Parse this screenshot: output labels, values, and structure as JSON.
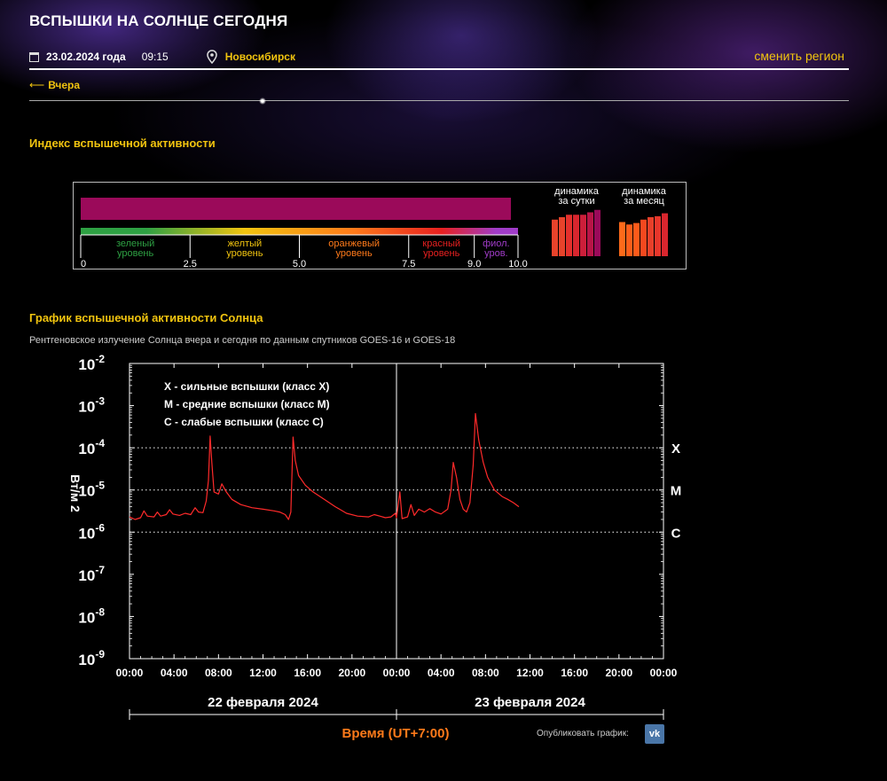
{
  "header": {
    "title": "Вспышки на Солнце сегодня",
    "date": "23.02.2024 года",
    "time": "09:15",
    "city": "Новосибирск",
    "change_region": "сменить регион",
    "back_label": "Вчера"
  },
  "flare_index": {
    "heading": "Индекс вспышечной активности",
    "value": 10.0,
    "scale_ticks": [
      "0",
      "2.5",
      "5.0",
      "7.5",
      "9.0",
      "10.0"
    ],
    "levels": [
      {
        "label": "зеленый уровень",
        "line1": "зеленый",
        "line2": "уровень",
        "range": [
          0,
          2.5
        ],
        "color": "#2ea043"
      },
      {
        "label": "желтый уровень",
        "line1": "желтый",
        "line2": "уровень",
        "range": [
          2.5,
          5.0
        ],
        "color": "#f1c40f"
      },
      {
        "label": "оранжевый уровень",
        "line1": "оранжевый",
        "line2": "уровень",
        "range": [
          5.0,
          7.5
        ],
        "color": "#ff7a1a"
      },
      {
        "label": "красный уровень",
        "line1": "красный",
        "line2": "уровень",
        "range": [
          7.5,
          9.0
        ],
        "color": "#e82020"
      },
      {
        "label": "фиол. уров.",
        "line1": "фиол.",
        "line2": "уров.",
        "range": [
          9.0,
          10.0
        ],
        "color": "#a03cc8"
      }
    ],
    "bar_color": "#9b0a5a",
    "daily": {
      "label_line1": "динамика",
      "label_line2": "за сутки",
      "values": [
        0.75,
        0.8,
        0.85,
        0.85,
        0.85,
        0.9,
        0.95
      ]
    },
    "monthly": {
      "label_line1": "динамика",
      "label_line2": "за месяц",
      "values": [
        0.7,
        0.65,
        0.68,
        0.75,
        0.8,
        0.82,
        0.88
      ]
    }
  },
  "graph": {
    "heading": "График вспышечной активности Солнца",
    "subtitle": "Рентгеновское излучение Солнца вчера и сегодня по данным спутников GOES-16 и GOES-18",
    "publish_label": "Опубликовать график:",
    "vk_label": "vk"
  },
  "chart_data": {
    "type": "line",
    "ylabel": "Вт/м 2",
    "xlabel": "Время (UT+7:00)",
    "y_scale": "log",
    "ylim": [
      1e-09,
      0.01
    ],
    "y_ticks": [
      {
        "base": "10",
        "exp": "-2",
        "value": 0.01
      },
      {
        "base": "10",
        "exp": "-3",
        "value": 0.001
      },
      {
        "base": "10",
        "exp": "-4",
        "value": 0.0001
      },
      {
        "base": "10",
        "exp": "-5",
        "value": 1e-05
      },
      {
        "base": "10",
        "exp": "-6",
        "value": 1e-06
      },
      {
        "base": "10",
        "exp": "-7",
        "value": 1e-07
      },
      {
        "base": "10",
        "exp": "-8",
        "value": 1e-08
      },
      {
        "base": "10",
        "exp": "-9",
        "value": 1e-09
      }
    ],
    "xlim": [
      0,
      48
    ],
    "x_ticks": [
      "00:00",
      "04:00",
      "08:00",
      "12:00",
      "16:00",
      "20:00",
      "00:00",
      "04:00",
      "08:00",
      "12:00",
      "16:00",
      "20:00",
      "00:00"
    ],
    "day_labels": [
      "22 февраля 2024",
      "23 февраля 2024"
    ],
    "class_lines": [
      {
        "label": "X",
        "value": 0.0001
      },
      {
        "label": "M",
        "value": 1e-05
      },
      {
        "label": "C",
        "value": 1e-06
      }
    ],
    "legend": [
      "X - сильные вспышки (класс X)",
      "M - средние вспышки (класс M)",
      "C - слабые вспышки (класс C)"
    ],
    "series": [
      {
        "color": "#ff2a2a",
        "points": [
          [
            0.0,
            2.3e-06
          ],
          [
            0.5,
            2e-06
          ],
          [
            1.0,
            2.2e-06
          ],
          [
            1.3,
            3.2e-06
          ],
          [
            1.6,
            2.4e-06
          ],
          [
            2.2,
            2.3e-06
          ],
          [
            2.5,
            3e-06
          ],
          [
            2.8,
            2.4e-06
          ],
          [
            3.3,
            2.6e-06
          ],
          [
            3.6,
            3.4e-06
          ],
          [
            3.9,
            2.7e-06
          ],
          [
            4.5,
            2.5e-06
          ],
          [
            5.0,
            2.8e-06
          ],
          [
            5.5,
            2.6e-06
          ],
          [
            5.9,
            3.8e-06
          ],
          [
            6.2,
            3e-06
          ],
          [
            6.6,
            2.9e-06
          ],
          [
            6.9,
            5.5e-06
          ],
          [
            7.1,
            1.7e-05
          ],
          [
            7.25,
            0.00019
          ],
          [
            7.4,
            4.5e-05
          ],
          [
            7.6,
            9e-06
          ],
          [
            8.0,
            8e-06
          ],
          [
            8.3,
            1.4e-05
          ],
          [
            8.7,
            9e-06
          ],
          [
            9.2,
            6e-06
          ],
          [
            10.0,
            4.5e-06
          ],
          [
            11.0,
            3.8e-06
          ],
          [
            12.0,
            3.5e-06
          ],
          [
            13.0,
            3.2e-06
          ],
          [
            13.5,
            3e-06
          ],
          [
            14.0,
            2.6e-06
          ],
          [
            14.3,
            2e-06
          ],
          [
            14.5,
            3e-06
          ],
          [
            14.7,
            0.00018
          ],
          [
            14.9,
            5e-05
          ],
          [
            15.2,
            2.2e-05
          ],
          [
            15.8,
            1.3e-05
          ],
          [
            16.5,
            9e-06
          ],
          [
            17.5,
            6e-06
          ],
          [
            18.5,
            4e-06
          ],
          [
            19.5,
            2.8e-06
          ],
          [
            20.5,
            2.4e-06
          ],
          [
            21.5,
            2.3e-06
          ],
          [
            22.0,
            2.6e-06
          ],
          [
            22.5,
            2.4e-06
          ],
          [
            23.0,
            2.2e-06
          ],
          [
            23.5,
            2.3e-06
          ],
          [
            23.9,
            2.8e-06
          ],
          [
            24.0,
            2.2e-06
          ],
          [
            24.3,
            9e-06
          ],
          [
            24.5,
            2.1e-06
          ],
          [
            25.0,
            2.3e-06
          ],
          [
            25.3,
            4.5e-06
          ],
          [
            25.6,
            2.5e-06
          ],
          [
            26.0,
            3.5e-06
          ],
          [
            26.5,
            3e-06
          ],
          [
            27.0,
            3.6e-06
          ],
          [
            27.5,
            3e-06
          ],
          [
            28.0,
            2.7e-06
          ],
          [
            28.6,
            3.5e-06
          ],
          [
            28.9,
            1e-05
          ],
          [
            29.1,
            4.5e-05
          ],
          [
            29.4,
            2e-05
          ],
          [
            29.7,
            6e-06
          ],
          [
            30.0,
            3.5e-06
          ],
          [
            30.3,
            3e-06
          ],
          [
            30.6,
            5e-06
          ],
          [
            30.9,
            4e-05
          ],
          [
            31.1,
            0.00065
          ],
          [
            31.4,
            0.00015
          ],
          [
            31.8,
            4.5e-05
          ],
          [
            32.2,
            2e-05
          ],
          [
            32.8,
            1e-05
          ],
          [
            33.5,
            7e-06
          ],
          [
            34.0,
            6e-06
          ],
          [
            34.5,
            5e-06
          ],
          [
            35.0,
            4e-06
          ]
        ]
      }
    ]
  }
}
